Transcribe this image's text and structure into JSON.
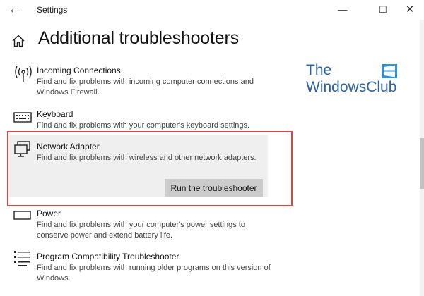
{
  "window": {
    "title": "Settings",
    "back_glyph": "←",
    "min_glyph": "—",
    "max_glyph": "☐",
    "close_glyph": "✕"
  },
  "header": {
    "title": "Additional troubleshooters",
    "home_icon": "home-icon"
  },
  "logo": {
    "line1": "The",
    "line2": "WindowsClub",
    "color": "#2a63a6"
  },
  "items": [
    {
      "name": "Incoming Connections",
      "description": "Find and fix problems with incoming computer connections and Windows Firewall.",
      "icon": "antenna-icon"
    },
    {
      "name": "Keyboard",
      "description": "Find and fix problems with your computer's keyboard settings.",
      "icon": "keyboard-icon"
    },
    {
      "name": "Network Adapter",
      "description": "Find and fix problems with wireless and other network adapters.",
      "icon": "network-adapter-icon",
      "selected": true
    },
    {
      "name": "Power",
      "description": "Find and fix problems with your computer's power settings to conserve power and extend battery life.",
      "icon": "battery-icon"
    },
    {
      "name": "Program Compatibility Troubleshooter",
      "description": "Find and fix problems with running older programs on this version of Windows.",
      "icon": "program-list-icon"
    }
  ],
  "run_button": {
    "label": "Run the troubleshooter"
  },
  "colors": {
    "highlight_border": "#d04a4a",
    "selected_bg": "#efefef",
    "button_bg": "#cccccc"
  }
}
